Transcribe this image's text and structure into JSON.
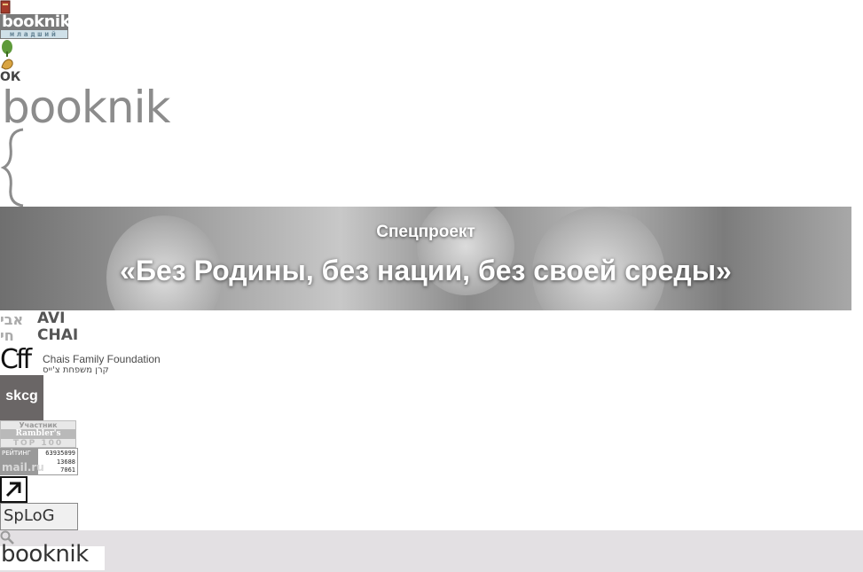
{
  "header": {
    "junior_logo_text": "booknik",
    "junior_logo_sub": "младший",
    "main_logo_text": "booknik",
    "ok_text": "ОК"
  },
  "banner": {
    "subtitle": "Спецпроект",
    "title": "«Без Родины, без нации, без своей среды»"
  },
  "sponsors": {
    "avichai_text": "AVI CHAI",
    "avichai_hebrew": "אבי חי",
    "chais_name": "Chais Family Foundation",
    "chais_hebrew": "קרן משפחת צ'ייס",
    "skcg": "skcg"
  },
  "counters": {
    "rambler_line1": "Участник",
    "rambler_line2": "Rambler's",
    "rambler_line3": "TOP 100",
    "mailru_label1": "РЕЙТИНГ",
    "mailru_label2": "mail.ru",
    "mailru_num1": "63935099",
    "mailru_num2": "13688",
    "mailru_num3": "7061",
    "splog_text": "SpLoG"
  },
  "footer": {
    "logo_text": "booknik"
  }
}
